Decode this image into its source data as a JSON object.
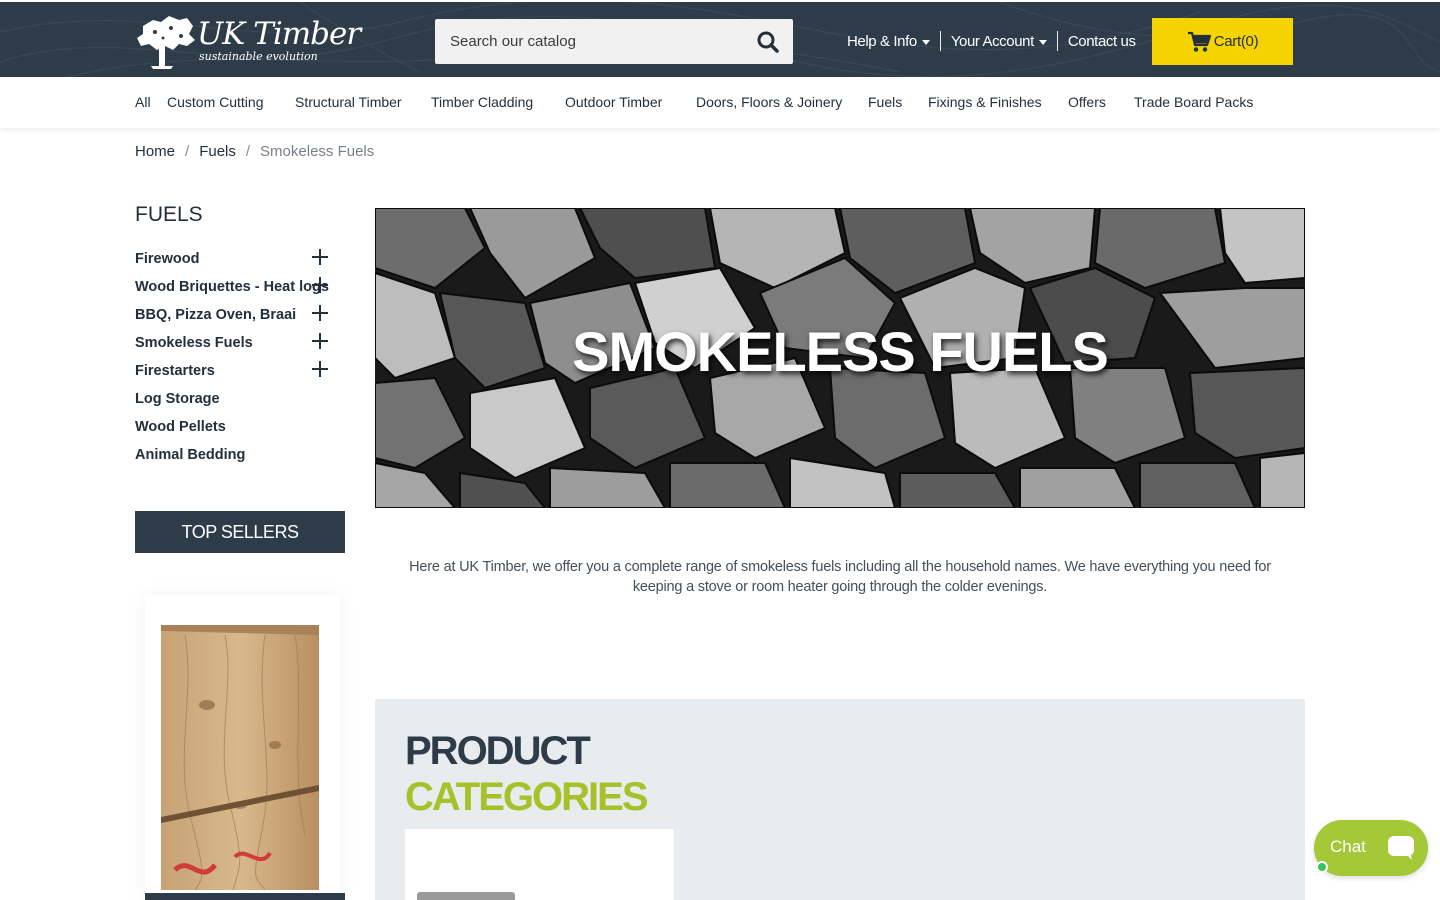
{
  "brand": {
    "name": "UK Timber",
    "tagline": "sustainable evolution"
  },
  "search": {
    "placeholder": "Search our catalog"
  },
  "top_links": {
    "help": "Help & Info",
    "account": "Your Account",
    "contact": "Contact us"
  },
  "cart": {
    "label": "Cart",
    "count": "(0)"
  },
  "menu": {
    "items": [
      "All",
      "Custom Cutting",
      "Structural Timber",
      "Timber Cladding",
      "Outdoor Timber",
      "Doors, Floors & Joinery",
      "Fuels",
      "Fixings & Finishes",
      "Offers",
      "Trade Board Packs"
    ]
  },
  "breadcrumb": {
    "items": [
      "Home",
      "Fuels",
      "Smokeless Fuels"
    ],
    "separator": "/"
  },
  "sidebar": {
    "title": "FUELS",
    "categories": [
      {
        "label": "Firewood",
        "expandable": true
      },
      {
        "label": "Wood Briquettes - Heat logs",
        "expandable": true
      },
      {
        "label": "BBQ, Pizza Oven, Braai",
        "expandable": true
      },
      {
        "label": "Smokeless Fuels",
        "expandable": true
      },
      {
        "label": "Firestarters",
        "expandable": true
      },
      {
        "label": "Log Storage",
        "expandable": false
      },
      {
        "label": "Wood Pellets",
        "expandable": false
      },
      {
        "label": "Animal Bedding",
        "expandable": false
      }
    ],
    "top_sellers": "TOP SELLERS"
  },
  "hero": {
    "title": "SMOKELESS FUELS"
  },
  "intro": {
    "text": "Here at UK Timber, we offer you a complete range of smokeless fuels including all the household names. We have everything you need for keeping a stove or room heater going through the colder evenings."
  },
  "product_categories": {
    "line1": "PRODUCT",
    "line2": "CATEGORIES"
  },
  "chat": {
    "label": "Chat"
  },
  "colors": {
    "header_bg": "#2e3c49",
    "cart_yellow": "#f5d300",
    "accent_green": "#a8c02a",
    "chat_green": "#a4c838",
    "panel_bg": "#e9ecef"
  },
  "icons": [
    "search-icon",
    "cart-icon",
    "caret-down-icon",
    "plus-icon",
    "chat-bubble-icon",
    "logo-tree-icon"
  ]
}
